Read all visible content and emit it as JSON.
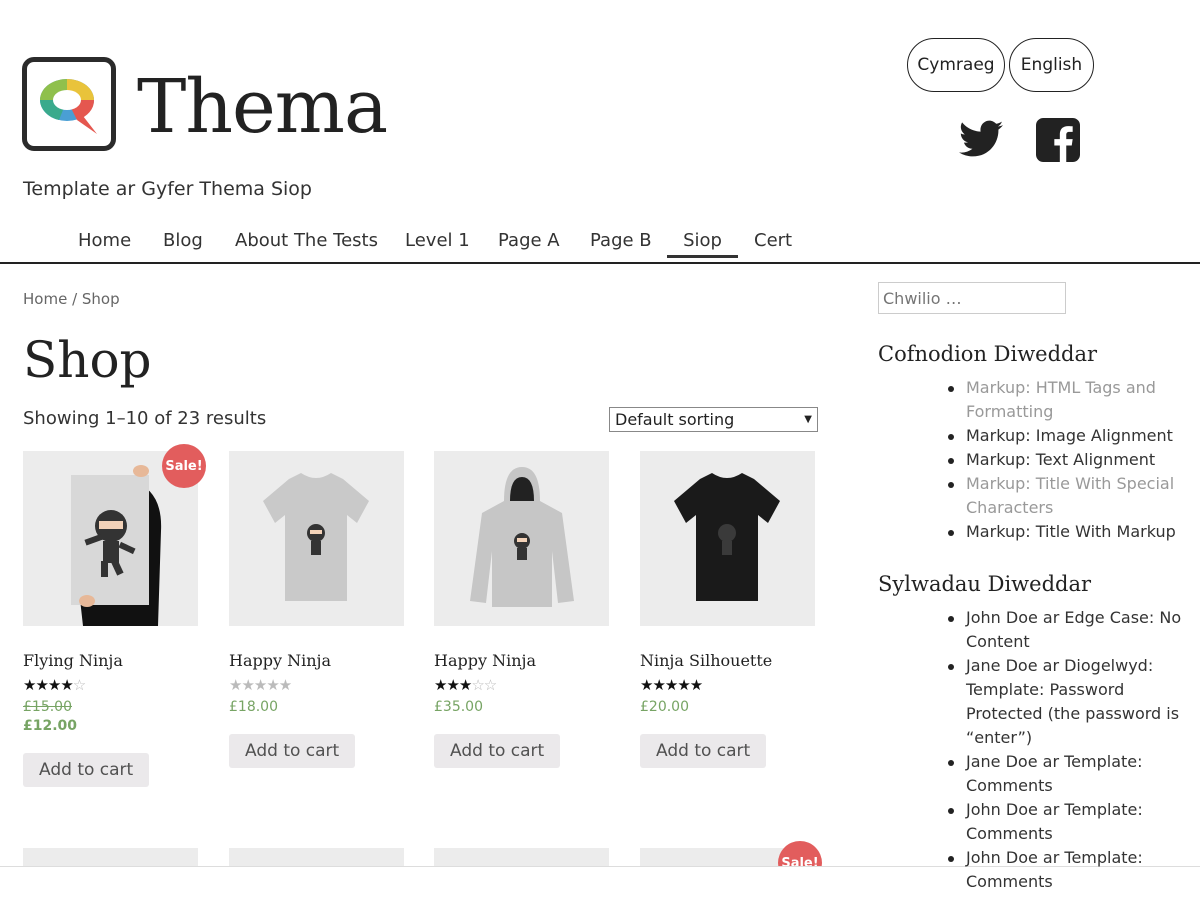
{
  "site": {
    "title": "Thema",
    "tagline": "Template ar Gyfer Thema Siop"
  },
  "languages": [
    "Cymraeg",
    "English"
  ],
  "social": {
    "twitter": "twitter-icon",
    "facebook": "facebook-icon"
  },
  "nav": {
    "items": [
      "Home",
      "Blog",
      "About The Tests",
      "Level 1",
      "Page A",
      "Page B",
      "Siop",
      "Cert"
    ],
    "active": "Siop"
  },
  "breadcrumb": "Home / Shop",
  "page_title": "Shop",
  "result_count": "Showing 1–10 of 23 results",
  "sorting": {
    "selected": "Default sorting"
  },
  "products": [
    {
      "name": "Flying Ninja",
      "rating": 4,
      "regular_price": "£15.00",
      "price": "£12.00",
      "on_sale": true,
      "sale_label": "Sale!",
      "button": "Add to cart"
    },
    {
      "name": "Happy Ninja",
      "rating": 0,
      "price": "£18.00",
      "on_sale": false,
      "button": "Add to cart"
    },
    {
      "name": "Happy Ninja",
      "rating": 3,
      "price": "£35.00",
      "on_sale": false,
      "button": "Add to cart"
    },
    {
      "name": "Ninja Silhouette",
      "rating": 5,
      "price": "£20.00",
      "on_sale": false,
      "button": "Add to cart"
    }
  ],
  "row2_sale_label": "Sale!",
  "search": {
    "placeholder": "Chwilio …"
  },
  "recent_posts": {
    "title": "Cofnodion Diweddar",
    "items": [
      {
        "text": "Markup: HTML Tags and Formatting",
        "muted": true
      },
      {
        "text": "Markup: Image Alignment",
        "muted": false
      },
      {
        "text": "Markup: Text Alignment",
        "muted": false
      },
      {
        "text": "Markup: Title With Special Characters",
        "muted": true
      },
      {
        "text": "Markup: Title With Markup",
        "muted": false
      }
    ]
  },
  "recent_comments": {
    "title": "Sylwadau Diweddar",
    "items": [
      "John Doe ar Edge Case: No Content",
      "Jane Doe ar Diogelwyd: Template: Password Protected (the password is “enter”)",
      "Jane Doe ar Template: Comments",
      "John Doe ar Template: Comments",
      "John Doe ar Template: Comments"
    ]
  },
  "colors": {
    "accent": "#77a464",
    "sale": "#e25d5d",
    "button_bg": "#ebe9eb"
  }
}
